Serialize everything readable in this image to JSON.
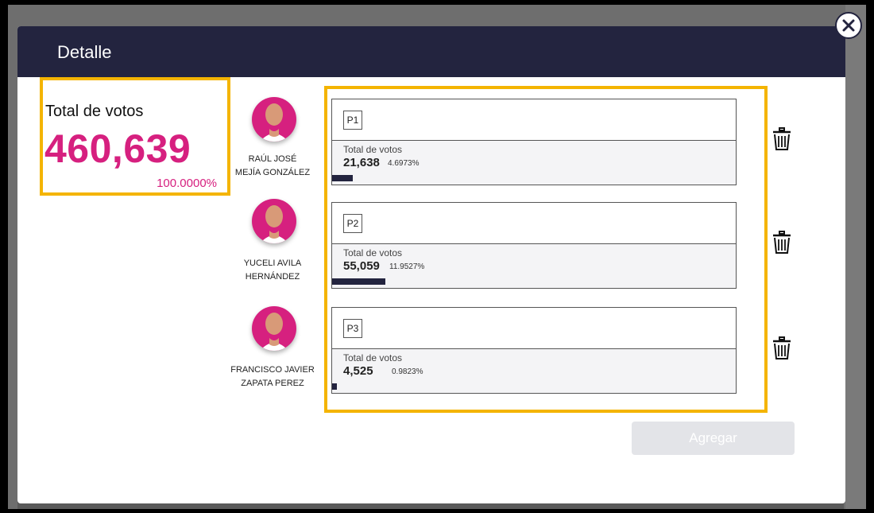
{
  "modal": {
    "title": "Detalle",
    "total_label": "Total de votos",
    "total_value": "460,639",
    "total_percent": "100.0000%"
  },
  "candidates": [
    {
      "name_line1": "RAÚL JOSÉ",
      "name_line2": "MEJÍA GONZÁLEZ",
      "party": "P1",
      "votes_label": "Total de votos",
      "votes": "21,638",
      "percent": "4.6973%",
      "share": 0.046973
    },
    {
      "name_line1": "YUCELI AVILA",
      "name_line2": "HERNÁNDEZ",
      "party": "P2",
      "votes_label": "Total de votos",
      "votes": "55,059",
      "percent": "11.9527%",
      "share": 0.119527
    },
    {
      "name_line1": "FRANCISCO JAVIER",
      "name_line2": "ZAPATA PEREZ",
      "party": "P3",
      "votes_label": "Total de votos",
      "votes": "4,525",
      "percent": "0.9823%",
      "share": 0.009823
    }
  ],
  "actions": {
    "add_label": "Agregar"
  },
  "icons": {
    "close": "close-icon",
    "delete": "trash-icon",
    "avatar": "user-avatar-icon"
  },
  "colors": {
    "header": "#23243f",
    "accent": "#d6207f",
    "highlight": "#f4b400",
    "bar": "#23243f"
  }
}
